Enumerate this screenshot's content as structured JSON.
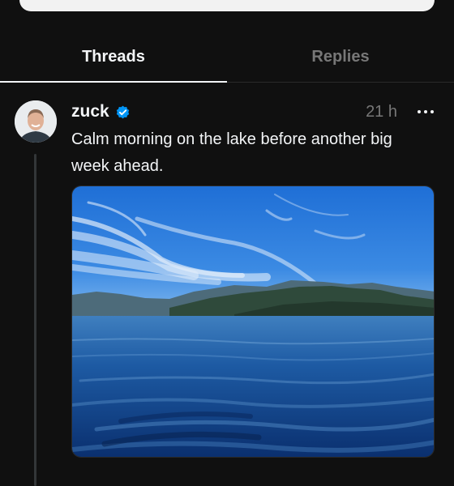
{
  "tabs": [
    {
      "label": "Threads",
      "active": true
    },
    {
      "label": "Replies",
      "active": false
    }
  ],
  "post": {
    "username": "zuck",
    "verified": true,
    "timestamp": "21 h",
    "caption": "Calm morning on the lake before another big week ahead.",
    "media": "lake-photo"
  },
  "colors": {
    "background": "#101010",
    "text": "#f3f5f7",
    "muted": "#777777",
    "verified": "#0095f6"
  },
  "icons": {
    "more": "more-horizontal-icon",
    "verified": "verified-badge-icon"
  }
}
